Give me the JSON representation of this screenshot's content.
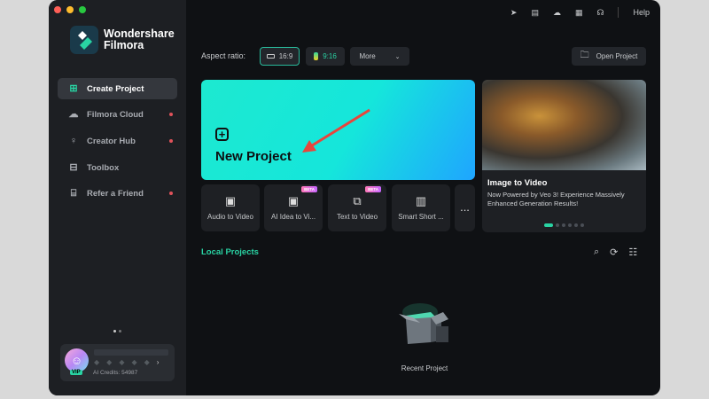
{
  "app": {
    "brand_line1": "Wondershare",
    "brand_line2": "Filmora"
  },
  "sidebar": {
    "items": [
      {
        "label": "Create Project",
        "icon": "file-plus-icon",
        "active": true,
        "dot": false
      },
      {
        "label": "Filmora Cloud",
        "icon": "cloud-icon",
        "dot": true
      },
      {
        "label": "Creator Hub",
        "icon": "lightbulb-icon",
        "dot": true
      },
      {
        "label": "Toolbox",
        "icon": "toolbox-icon",
        "dot": false
      },
      {
        "label": "Refer a Friend",
        "icon": "gift-icon",
        "dot": true
      }
    ]
  },
  "account": {
    "vip": "VIP",
    "credits": "AI Credits: 54987"
  },
  "topbar": {
    "help": "Help",
    "icons": [
      "send-icon",
      "calendar-icon",
      "cloud-upload-icon",
      "grid-icon",
      "headset-icon"
    ]
  },
  "aspect": {
    "label": "Aspect ratio:",
    "options": [
      "16:9",
      "9:16"
    ],
    "selected": "16:9",
    "more": "More"
  },
  "open_project": "Open Project",
  "new_project": "New Project",
  "tools": [
    {
      "label": "Audio to Video",
      "beta": false
    },
    {
      "label": "AI Idea to Vi...",
      "beta": true
    },
    {
      "label": "Text to Video",
      "beta": true
    },
    {
      "label": "Smart Short ...",
      "beta": false
    }
  ],
  "beta_label": "BETA",
  "more_tools": "...",
  "promo": {
    "title": "Image to Video",
    "desc": "Now Powered by Veo 3! Experience Massively Enhanced Generation Results!",
    "slides": 6,
    "current": 1
  },
  "local": {
    "title": "Local Projects",
    "empty": "Recent Project"
  },
  "colors": {
    "accent": "#29d3a3",
    "dot": "#e0525a"
  }
}
